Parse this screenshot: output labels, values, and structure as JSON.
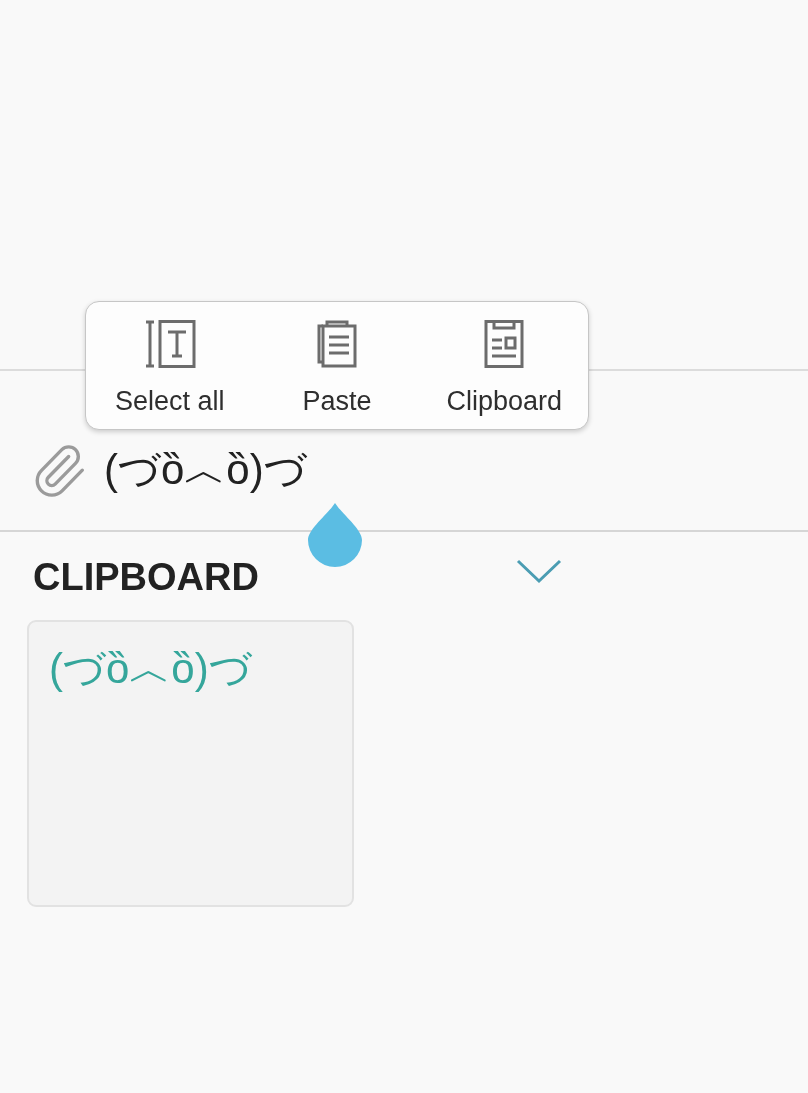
{
  "context_menu": {
    "items": [
      {
        "kind": "select_all",
        "label": "Select all"
      },
      {
        "kind": "paste",
        "label": "Paste"
      },
      {
        "kind": "clipboard",
        "label": "Clipboard"
      }
    ]
  },
  "text_field": {
    "value": "(づȍ︿ȍ)づ"
  },
  "clipboard": {
    "title": "CLIPBOARD",
    "items": [
      {
        "text": "(づȍ︿ȍ)づ"
      }
    ]
  }
}
